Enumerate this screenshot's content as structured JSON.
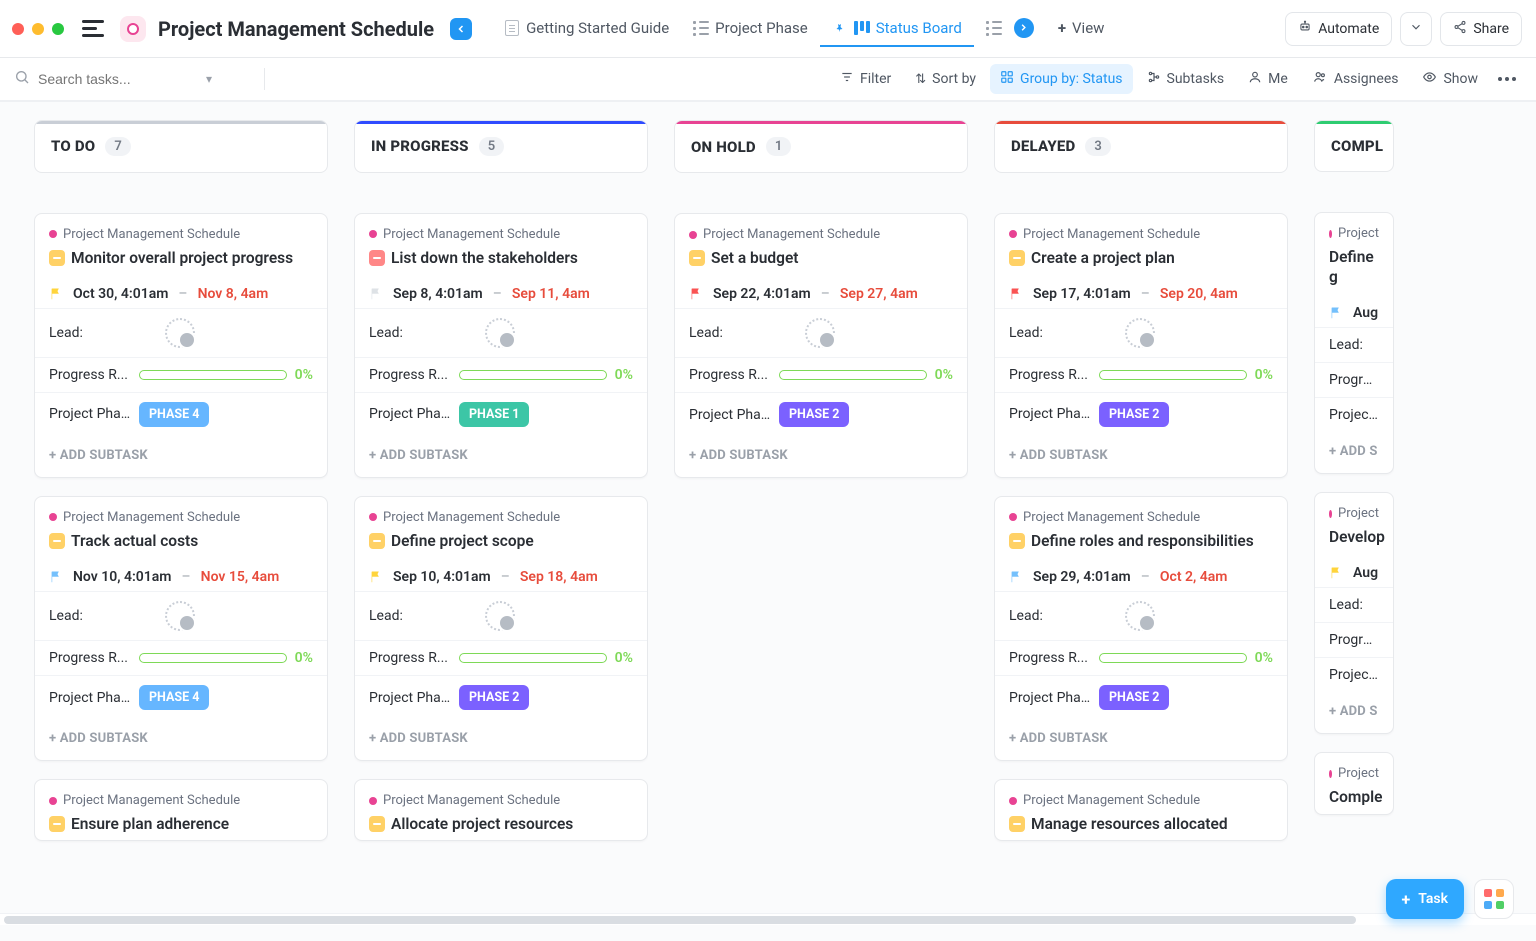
{
  "app": {
    "title": "Project Management Schedule",
    "search_placeholder": "Search tasks..."
  },
  "views": {
    "v0": {
      "label": "Getting Started Guide"
    },
    "v1": {
      "label": "Project Phase"
    },
    "v2": {
      "label": "Status Board"
    },
    "add_view": "View",
    "automate": "Automate",
    "share": "Share"
  },
  "toolbar": {
    "filter": "Filter",
    "sort": "Sort by",
    "group": "Group by: Status",
    "subtasks": "Subtasks",
    "me": "Me",
    "assignees": "Assignees",
    "show": "Show"
  },
  "fields": {
    "lead": "Lead:",
    "progress": "Progress R...",
    "phase": "Project Pha...",
    "add_sub": "+ ADD SUBTASK",
    "add_sub_short": "+ ADD S",
    "breadcrumb": "Project Management Schedule",
    "breadcrumb_short": "Project"
  },
  "phases": {
    "p1": "PHASE 1",
    "p2": "PHASE 2",
    "p4": "PHASE 4"
  },
  "columns": {
    "todo": {
      "title": "TO DO",
      "count": "7",
      "color": "#c9ced6"
    },
    "progress": {
      "title": "IN PROGRESS",
      "count": "5",
      "color": "#2f4bff"
    },
    "hold": {
      "title": "ON HOLD",
      "count": "1",
      "color": "#e84393"
    },
    "delayed": {
      "title": "DELAYED",
      "count": "3",
      "color": "#e74c3c"
    },
    "complete": {
      "title": "COMPL",
      "count": "",
      "color": "#2ecc71"
    }
  },
  "cards": {
    "c1": {
      "title": "Monitor overall project progress",
      "start": "Oct 30, 4:01am",
      "due": "Nov 8, 4am",
      "flag": "#ffd43b",
      "pct": "0%",
      "phase": "p4"
    },
    "c2": {
      "title": "Track actual costs",
      "start": "Nov 10, 4:01am",
      "due": "Nov 15, 4am",
      "flag": "#74c0fc",
      "pct": "0%",
      "phase": "p4"
    },
    "c3": {
      "title": "Ensure plan adherence",
      "start": "",
      "due": "",
      "flag": "",
      "pct": "",
      "phase": ""
    },
    "c4": {
      "title": "List down the stakeholders",
      "start": "Sep 8, 4:01am",
      "due": "Sep 11, 4am",
      "flag": "#dee2e6",
      "pct": "0%",
      "phase": "p1"
    },
    "c5": {
      "title": "Define project scope",
      "start": "Sep 10, 4:01am",
      "due": "Sep 18, 4am",
      "flag": "#ffd43b",
      "pct": "0%",
      "phase": "p2"
    },
    "c6": {
      "title": "Allocate project resources",
      "start": "",
      "due": "",
      "flag": "",
      "pct": "",
      "phase": ""
    },
    "c7": {
      "title": "Set a budget",
      "start": "Sep 22, 4:01am",
      "due": "Sep 27, 4am",
      "flag": "#fa5252",
      "pct": "0%",
      "phase": "p2"
    },
    "c8": {
      "title": "Create a project plan",
      "start": "Sep 17, 4:01am",
      "due": "Sep 20, 4am",
      "flag": "#fa5252",
      "pct": "0%",
      "phase": "p2"
    },
    "c9": {
      "title": "Define roles and responsibilities",
      "start": "Sep 29, 4:01am",
      "due": "Oct 2, 4am",
      "flag": "#74c0fc",
      "pct": "0%",
      "phase": "p2"
    },
    "c10": {
      "title": "Manage resources allocated",
      "start": "",
      "due": "",
      "flag": "",
      "pct": "",
      "phase": ""
    },
    "c11": {
      "title": "Define g",
      "start": "Aug",
      "due": "",
      "flag": "#74c0fc",
      "pct": "",
      "phase_label": "Project P",
      "progress_label": "Progress"
    },
    "c12": {
      "title": "Develop",
      "start": "Aug",
      "due": "",
      "flag": "#ffd43b",
      "pct": "",
      "phase_label": "Project P",
      "progress_label": "Progress"
    },
    "c13": {
      "title": "Comple"
    }
  },
  "fab": {
    "task": "Task"
  }
}
